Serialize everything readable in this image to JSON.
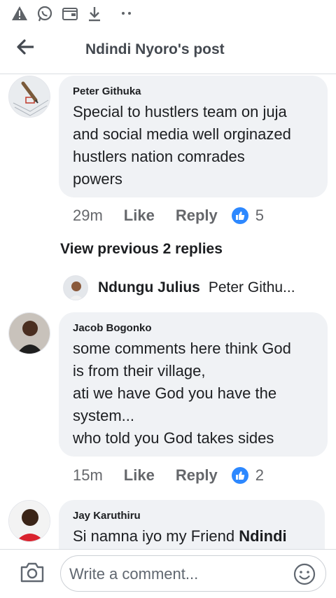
{
  "status_bar": {
    "icons": [
      "warning-icon",
      "whatsapp-icon",
      "wallet-icon",
      "download-icon",
      "more-dots-icon"
    ]
  },
  "header": {
    "title": "Ndindi Nyoro's post",
    "back_icon": "arrow-left-icon"
  },
  "comments": [
    {
      "author": "Peter Githuka",
      "lines": [
        "Special to hustlers team on juja",
        "and social media well orginazed",
        "hustlers nation comrades",
        "powers"
      ],
      "time": "29m",
      "like_label": "Like",
      "reply_label": "Reply",
      "reaction_count": "5"
    },
    {
      "author": "Jacob Bogonko",
      "lines": [
        "some comments here think God",
        "is from their village,",
        "ati we have God you have the",
        "system...",
        "who told you God takes sides"
      ],
      "time": "15m",
      "like_label": "Like",
      "reply_label": "Reply",
      "reaction_count": "2"
    },
    {
      "author": "Jay Karuthiru",
      "text_plain": "Si namna iyo my Friend ",
      "text_mention": "Ndindi"
    }
  ],
  "view_previous": "View previous 2 replies",
  "reply_preview": {
    "name": "Ndungu Julius",
    "snippet": "Peter Githu..."
  },
  "composer": {
    "placeholder": "Write a comment...",
    "camera_icon": "camera-icon",
    "emoji_icon": "emoji-icon"
  },
  "colors": {
    "bubble": "#f0f2f5",
    "reaction_blue": "#2d88ff",
    "meta_gray": "#65676b"
  }
}
